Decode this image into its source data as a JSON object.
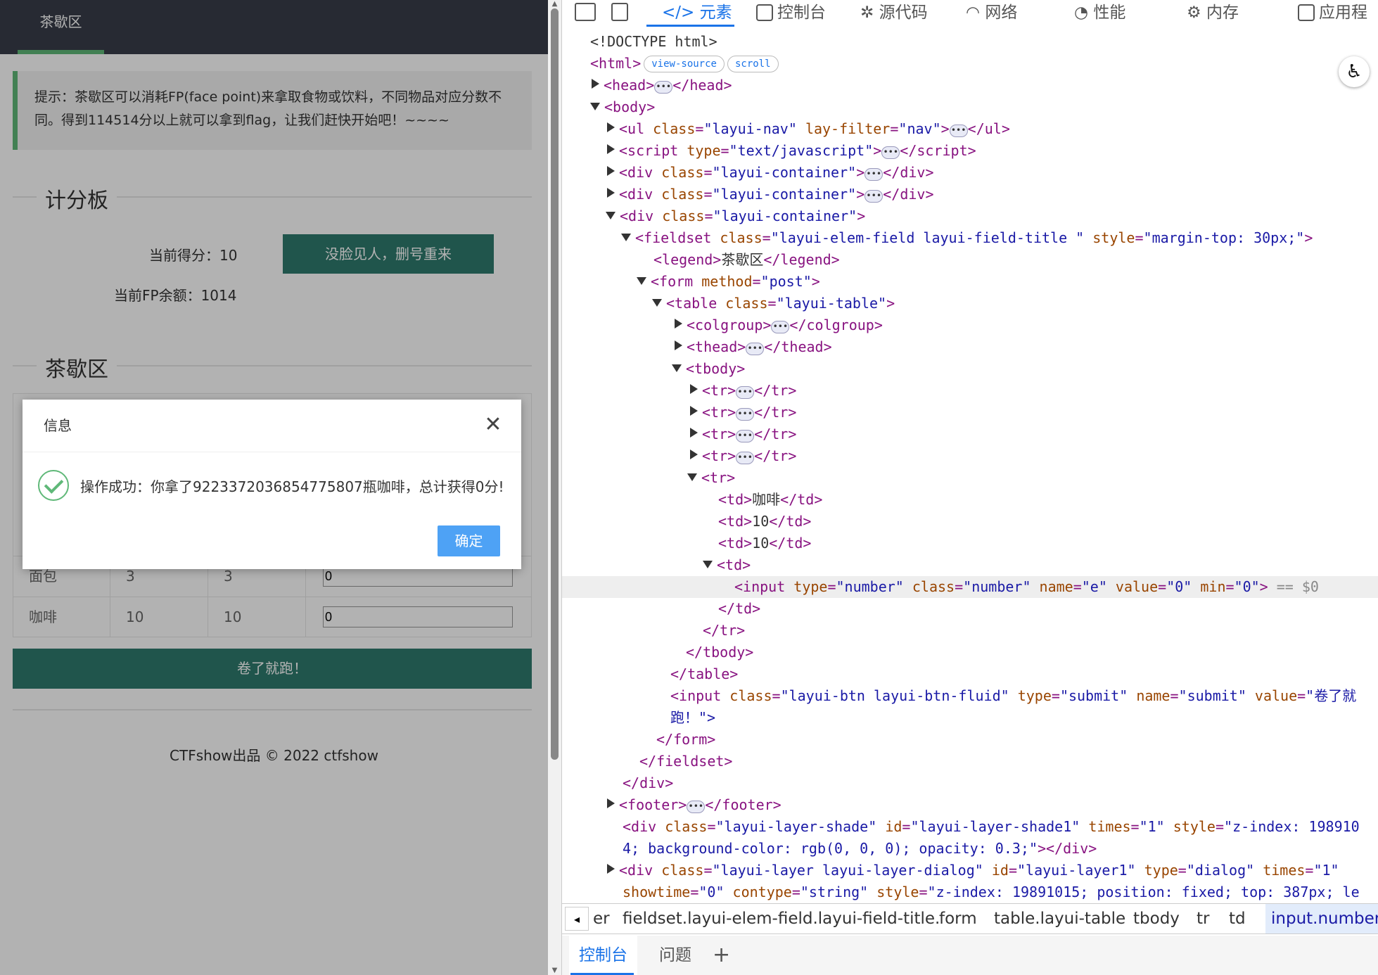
{
  "page": {
    "nav_item": "茶歇区",
    "tip": "提示：茶歇区可以消耗FP(face point)来拿取食物或饮料，不同物品对应分数不同。得到114514分以上就可以拿到flag，让我们赶快开始吧！~~~~",
    "scoreboard_legend": "计分板",
    "current_score": "当前得分：10",
    "fp_balance": "当前FP余额：1014",
    "reset_button": "没脸见人，删号重来",
    "tea_legend": "茶歇区",
    "rows": [
      {
        "name": "面包",
        "price": "3",
        "score": "3",
        "qty": "0"
      },
      {
        "name": "咖啡",
        "price": "10",
        "score": "10",
        "qty": "0"
      }
    ],
    "submit_button": "卷了就跑！",
    "footer": "CTFshow出品 © 2022 ctfshow"
  },
  "dialog": {
    "title": "信息",
    "close": "✕",
    "message": "操作成功：你拿了9223372036854775807瓶咖啡，总计获得0分!",
    "ok": "确定"
  },
  "devtools": {
    "tabs": [
      "元素",
      "控制台",
      "源代码",
      "网络",
      "性能",
      "内存",
      "应用程"
    ],
    "badges": [
      "view-source",
      "scroll"
    ],
    "selected_suffix": "== $0",
    "breadcrumbs": [
      "er",
      "fieldset.layui-elem-field.layui-field-title.",
      "form",
      "table.layui-table",
      "tbody",
      "tr",
      "td",
      "input.number"
    ],
    "drawer_tabs": [
      "控制台",
      "问题"
    ],
    "drawer_add": "+",
    "code": {
      "doctype": "<!DOCTYPE html>",
      "td_coffee": "咖啡",
      "td_val": "10",
      "submit_value_a": "卷了就",
      "submit_value_b": "跑！\">",
      "legend_text": "茶歇区"
    }
  }
}
